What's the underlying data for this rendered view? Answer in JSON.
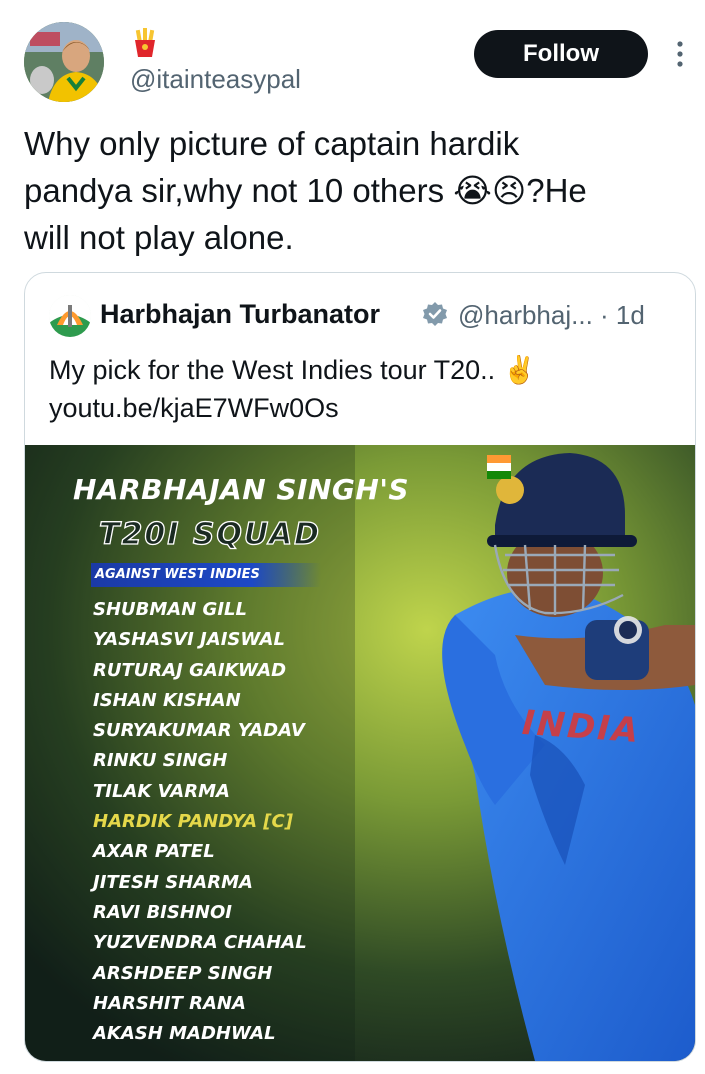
{
  "tweet": {
    "author_emoji": "🍟",
    "handle": "@itainteasypal",
    "follow_label": "Follow",
    "text": "Why only picture of captain hardik\npandya sir,why not 10 others 😭😣?He\nwill not play alone."
  },
  "quote": {
    "name": "Harbhajan Turbanator",
    "handle_time": "@harbhaj... · 1d",
    "text": "My pick for the West Indies tour T20.. ✌️",
    "link": "youtu.be/kjaE7WFw0Os",
    "image": {
      "title": "HARBHAJAN SINGH'S",
      "subtitle": "T20I SQUAD",
      "against": "AGAINST WEST INDIES",
      "jersey_text": "INDIA",
      "players": [
        "SHUBMAN GILL",
        "YASHASVI JAISWAL",
        "RUTURAJ GAIKWAD",
        "ISHAN KISHAN",
        "SURYAKUMAR YADAV",
        "RINKU SINGH",
        "TILAK VARMA",
        "HARDIK PANDYA [C]",
        "AXAR PATEL",
        "JITESH SHARMA",
        "RAVI BISHNOI",
        "YUZVENDRA CHAHAL",
        "ARSHDEEP SINGH",
        "HARSHIT RANA",
        "AKASH MADHWAL"
      ],
      "captain": "HARDIK PANDYA [C]"
    }
  },
  "colors": {
    "follow_bg": "#0f1419",
    "secondary_text": "#536471",
    "verified": "#829aab",
    "captain_highlight": "#e5d84a",
    "against_bar": "#1d49c6"
  }
}
